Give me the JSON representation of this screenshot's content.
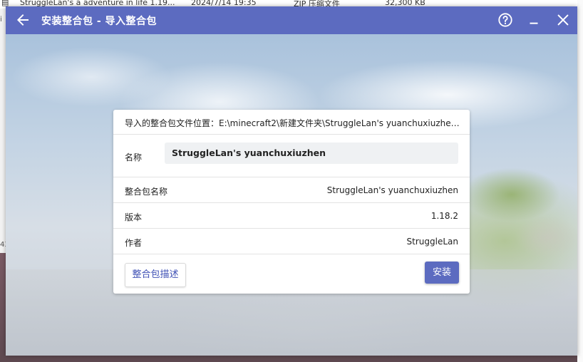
{
  "background": {
    "explorer_row": {
      "name": "StruggleLan's a adventure in life 1.19...",
      "date": "2024/7/14 19:35",
      "type": "ZIP 压缩文件",
      "size": "32,300 KB"
    },
    "left_fragments": [
      "i",
      "43"
    ]
  },
  "window": {
    "title": "安装整合包 - 导入整合包",
    "back_icon": "arrow-left-icon",
    "help_icon": "help-circle-icon",
    "minimize_icon": "minimize-icon",
    "close_icon": "close-icon",
    "accent_color": "#5c6bc0"
  },
  "dialog": {
    "path_label": "导入的整合包文件位置：E:\\minecraft2\\新建文件夹\\StruggleLan's yuanchuxiuzhen ...",
    "name_label": "名称",
    "name_value": "StruggleLan's yuanchuxiuzhen",
    "rows": [
      {
        "label": "整合包名称",
        "value": "StruggleLan's yuanchuxiuzhen"
      },
      {
        "label": "版本",
        "value": "1.18.2"
      },
      {
        "label": "作者",
        "value": "StruggleLan"
      }
    ],
    "description_button": "整合包描述",
    "install_button": "安装"
  }
}
